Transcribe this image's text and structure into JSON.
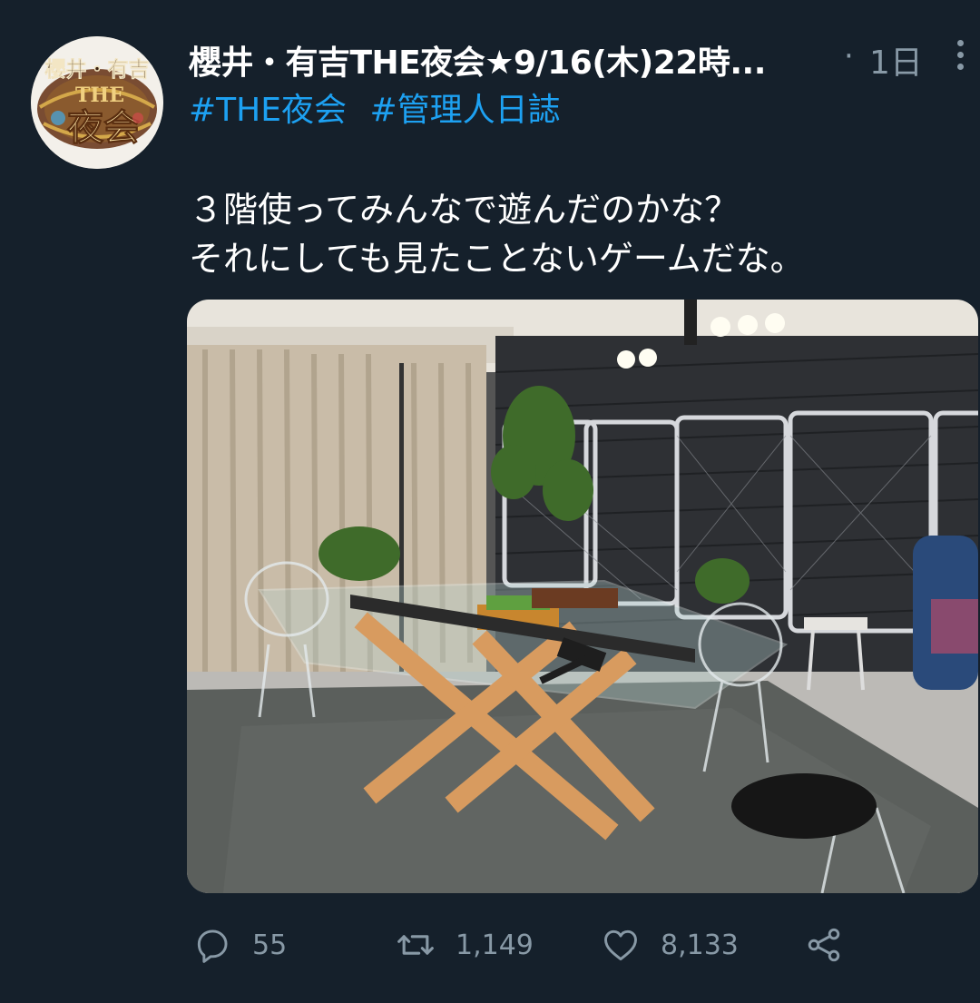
{
  "tweet": {
    "author_name": "櫻井・有吉THE夜会★9/16(木)22時...",
    "separator": "·",
    "timestamp": "1日",
    "hashtags": [
      "#THE夜会",
      "#管理人日誌"
    ],
    "text_lines": [
      "３階使ってみんなで遊んだのかな？",
      "それにしても見たことないゲームだな。"
    ],
    "avatar_text": {
      "top": "櫻井・有吉",
      "middle": "THE",
      "bottom": "夜会"
    },
    "media_description_icon": "photo"
  },
  "actions": {
    "reply_count": "55",
    "retweet_count": "1,149",
    "like_count": "8,133",
    "icons": [
      "reply-icon",
      "retweet-icon",
      "like-icon",
      "share-icon"
    ]
  },
  "colors": {
    "background": "#15202b",
    "link": "#1da1f2",
    "secondary_text": "#8899a6",
    "primary_text": "#ffffff"
  }
}
